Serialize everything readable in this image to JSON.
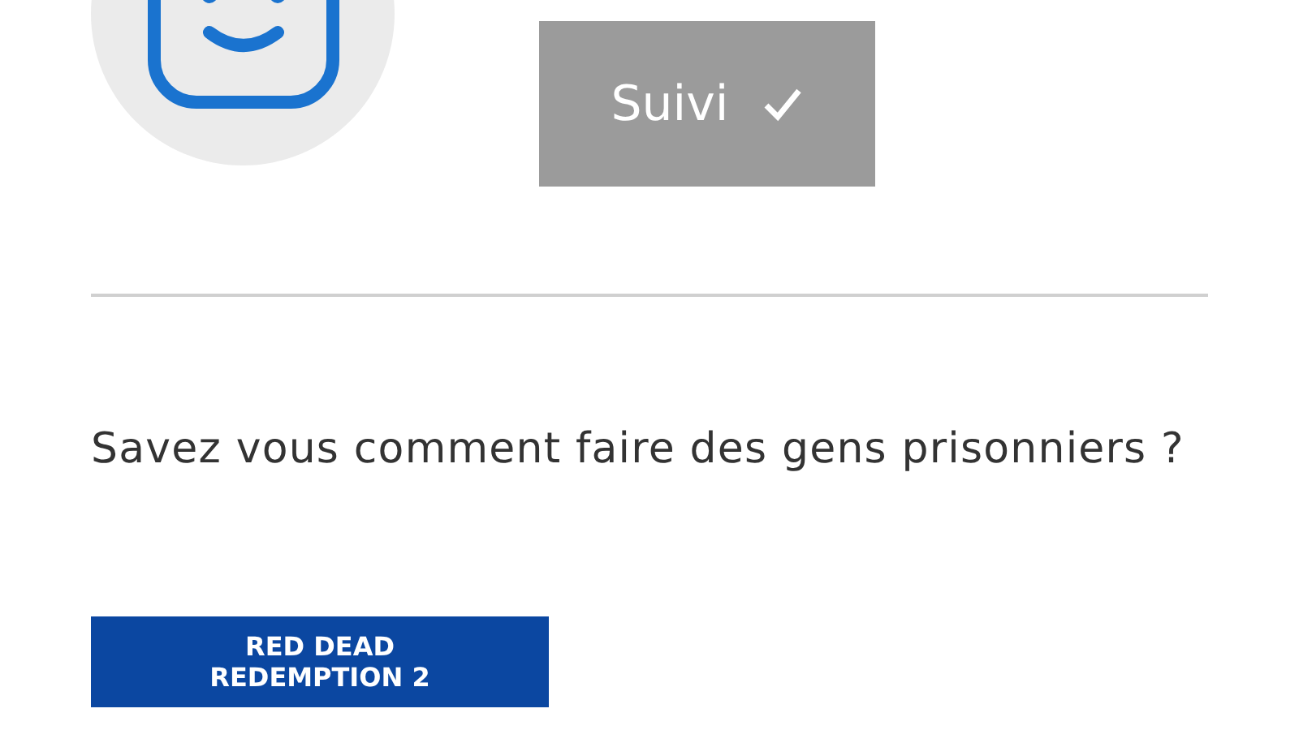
{
  "follow_button": {
    "label": "Suivi",
    "selected": true
  },
  "question": {
    "text": "Savez vous comment faire des gens prisonniers ?"
  },
  "tags": [
    {
      "label": "RED DEAD REDEMPTION 2"
    }
  ]
}
